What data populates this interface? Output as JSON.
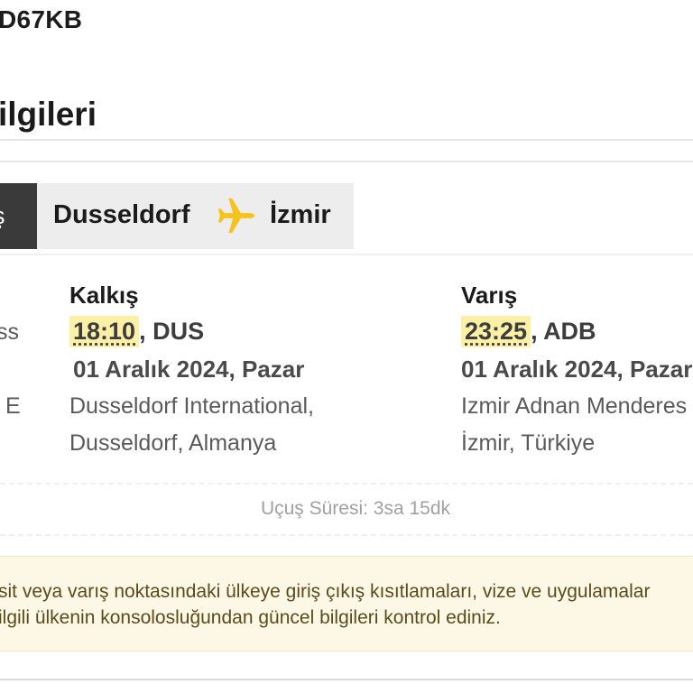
{
  "booking": {
    "pnr": "D67KB"
  },
  "section": {
    "title": "ilgileri"
  },
  "tab": {
    "active_label": "ş"
  },
  "route": {
    "from": "Dusseldorf",
    "to": "İzmir",
    "icon": "plane-icon",
    "icon_color": "#f6c21c"
  },
  "left_cut": {
    "line1": "ss",
    "line2": "E"
  },
  "departure": {
    "label": "Kalkış",
    "time": "18:10",
    "code": ", DUS",
    "date": "01 Aralık 2024, Pazar",
    "airport_line1": "Dusseldorf International,",
    "airport_line2": "Dusseldorf, Almanya"
  },
  "arrival": {
    "label": "Varış",
    "time": "23:25",
    "code": ", ADB",
    "date": "01 Aralık 2024, Pazar",
    "airport_line1": "Izmir Adnan Menderes",
    "airport_line2": "İzmir, Türkiye"
  },
  "duration": {
    "text": "Uçuş Süresi: 3sa 15dk"
  },
  "notice": {
    "line1": "sit veya varış noktasındaki ülkeye giriş çıkış kısıtlamaları, vize ve uygulamalar",
    "line2": "ilgili ülkenin konsolosluğundan güncel bilgileri kontrol ediniz."
  },
  "colors": {
    "highlight": "#fbf0a6",
    "notice_bg": "#fdf7e6",
    "tab_dark": "#3a3a3a",
    "route_bg": "#ededed"
  }
}
